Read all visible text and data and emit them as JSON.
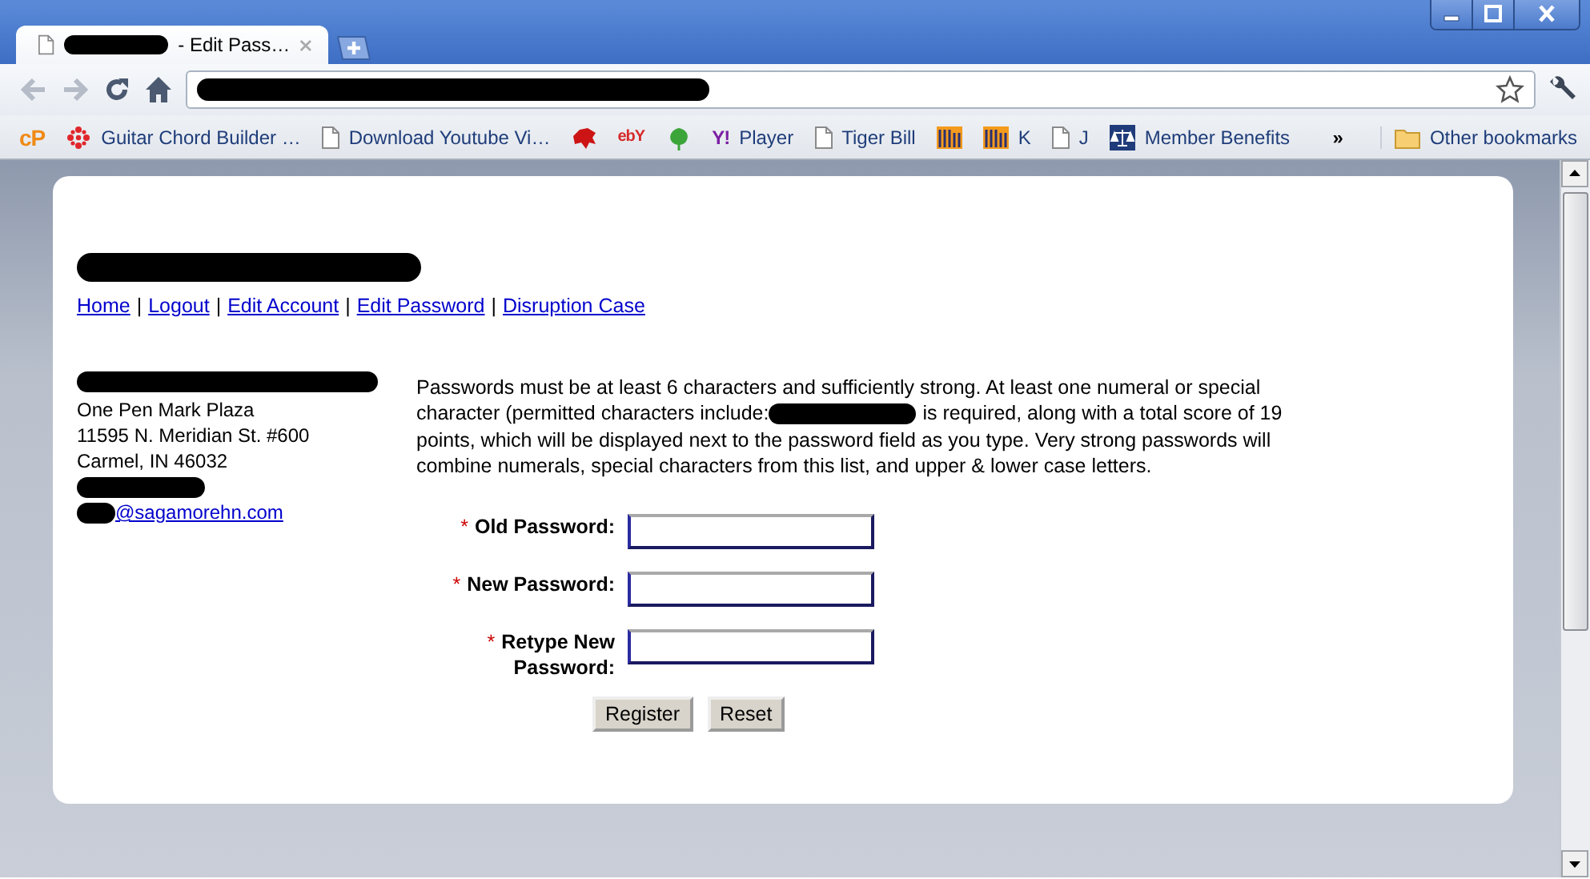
{
  "tabs": [
    {
      "title": "- Edit Pass…",
      "selected": true
    }
  ],
  "bookmarks": [
    {
      "kind": "logo",
      "logo": "cP"
    },
    {
      "kind": "flower",
      "label": "Guitar Chord Builder …"
    },
    {
      "kind": "page",
      "label": "Download Youtube Vi…"
    },
    {
      "kind": "dragon"
    },
    {
      "kind": "logo",
      "logo": "ebY"
    },
    {
      "kind": "leaf"
    },
    {
      "kind": "logo",
      "logo": "Y!",
      "label": "Player"
    },
    {
      "kind": "page",
      "label": "Tiger Bill"
    },
    {
      "kind": "bars"
    },
    {
      "kind": "bars",
      "label": "K"
    },
    {
      "kind": "page",
      "label": "J"
    },
    {
      "kind": "scales",
      "label": "Member Benefits"
    }
  ],
  "bookmarks_overflow": "»",
  "other_bookmarks": {
    "label": "Other bookmarks"
  },
  "nav": [
    {
      "kind": "link",
      "text": "Home"
    },
    {
      "kind": "separator",
      "text": "|"
    },
    {
      "kind": "link",
      "text": "Logout"
    },
    {
      "kind": "separator",
      "text": "|"
    },
    {
      "kind": "link",
      "text": "Edit Account"
    },
    {
      "kind": "separator",
      "text": "|"
    },
    {
      "kind": "link",
      "text": "Edit Password"
    },
    {
      "kind": "separator",
      "text": "|"
    },
    {
      "kind": "link",
      "text": "Disruption Case"
    }
  ],
  "address": {
    "lines": [
      "One Pen Mark Plaza",
      "11595 N. Meridian St. #600",
      "Carmel, IN 46032"
    ],
    "email": "@sagamorehn.com"
  },
  "intro": [
    {
      "kind": "line",
      "text": "Passwords must be at least 6 characters and sufficiently strong. At least one numeral or special"
    },
    {
      "kind": "split",
      "before": "character (permitted characters include:",
      "after": "is required, along with a total score of 19"
    },
    {
      "kind": "line",
      "text": "points, which will be displayed next to the password field as you type. Very strong passwords will"
    },
    {
      "kind": "line",
      "text": "combine numerals, special characters from this list, and upper & lower case letters."
    }
  ],
  "fields": [
    {
      "label": "Old Password:",
      "required": true,
      "required_mark": "*"
    },
    {
      "label": "New Password:",
      "required": true,
      "required_mark": "*"
    },
    {
      "label": "Retype New Password:",
      "required": true,
      "required_mark": "*"
    }
  ],
  "buttons": [
    "Register",
    "Reset"
  ]
}
